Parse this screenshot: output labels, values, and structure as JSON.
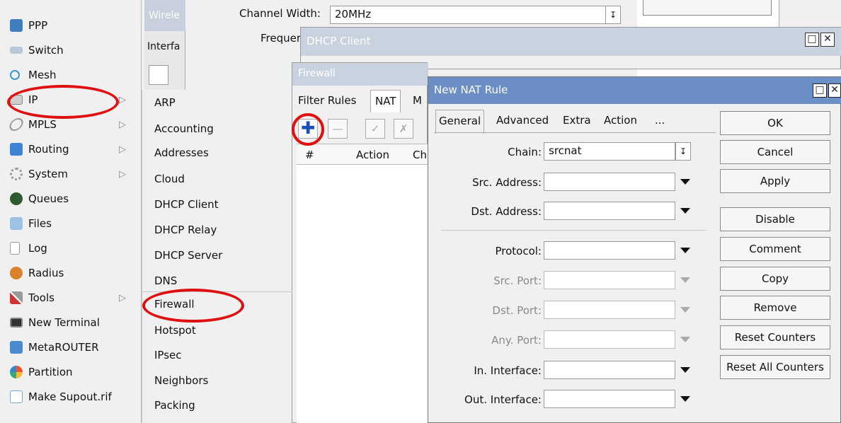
{
  "main_menu": [
    {
      "label": "PPP",
      "icon": "ppp-icon",
      "arrow": false
    },
    {
      "label": "Switch",
      "icon": "switch-icon",
      "arrow": false
    },
    {
      "label": "Mesh",
      "icon": "mesh-icon",
      "arrow": false
    },
    {
      "label": "IP",
      "icon": "ip-icon",
      "arrow": true
    },
    {
      "label": "MPLS",
      "icon": "mpls-icon",
      "arrow": true
    },
    {
      "label": "Routing",
      "icon": "routing-icon",
      "arrow": true
    },
    {
      "label": "System",
      "icon": "system-icon",
      "arrow": true
    },
    {
      "label": "Queues",
      "icon": "queues-icon",
      "arrow": false
    },
    {
      "label": "Files",
      "icon": "files-icon",
      "arrow": false
    },
    {
      "label": "Log",
      "icon": "log-icon",
      "arrow": false
    },
    {
      "label": "Radius",
      "icon": "radius-icon",
      "arrow": false
    },
    {
      "label": "Tools",
      "icon": "tools-icon",
      "arrow": true
    },
    {
      "label": "New Terminal",
      "icon": "terminal-icon",
      "arrow": false
    },
    {
      "label": "MetaROUTER",
      "icon": "metarouter-icon",
      "arrow": false
    },
    {
      "label": "Partition",
      "icon": "partition-icon",
      "arrow": false
    },
    {
      "label": "Make Supout.rif",
      "icon": "supout-icon",
      "arrow": false
    }
  ],
  "ip_submenu": [
    "ARP",
    "Accounting",
    "Addresses",
    "Cloud",
    "DHCP Client",
    "DHCP Relay",
    "DHCP Server",
    "DNS",
    "Firewall",
    "Hotspot",
    "IPsec",
    "Neighbors",
    "Packing"
  ],
  "wireless_window": {
    "title": "Wirele",
    "tab": "Interfa",
    "channel_width_label": "Channel Width:",
    "channel_width_value": "20MHz",
    "frequency_label": "Frequer"
  },
  "dhcp_window": {
    "title": "DHCP Client"
  },
  "firewall_window": {
    "title": "Firewall",
    "tabs": [
      "Filter Rules",
      "NAT",
      "M"
    ],
    "columns": [
      "#",
      "Action",
      "Ch"
    ]
  },
  "nat_dialog": {
    "title": "New NAT Rule",
    "tabs": [
      "General",
      "Advanced",
      "Extra",
      "Action",
      "..."
    ],
    "fields": {
      "chain_label": "Chain:",
      "chain_value": "srcnat",
      "src_address_label": "Src. Address:",
      "dst_address_label": "Dst. Address:",
      "protocol_label": "Protocol:",
      "src_port_label": "Src. Port:",
      "dst_port_label": "Dst. Port:",
      "any_port_label": "Any. Port:",
      "in_interface_label": "In. Interface:",
      "out_interface_label": "Out. Interface:"
    },
    "buttons": [
      "OK",
      "Cancel",
      "Apply",
      "Disable",
      "Comment",
      "Copy",
      "Remove",
      "Reset Counters",
      "Reset All Counters"
    ]
  },
  "colors": {
    "highlight_ring": "#e01010",
    "nat_title_bar": "#6b8ec4",
    "add_button": "#1a4fb5"
  }
}
